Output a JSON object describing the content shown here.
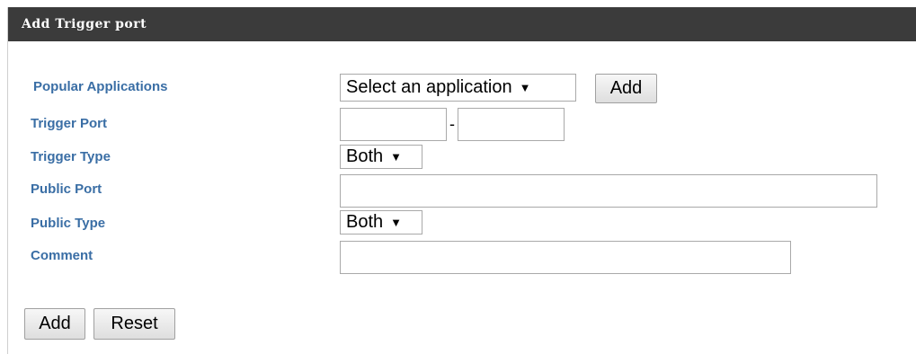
{
  "header": {
    "title": "Add Trigger port"
  },
  "form": {
    "popular_applications": {
      "label": "Popular Applications",
      "select_value": "Select an application",
      "add_label": "Add"
    },
    "trigger_port": {
      "label": "Trigger Port",
      "start_value": "",
      "separator": "-",
      "end_value": ""
    },
    "trigger_type": {
      "label": "Trigger Type",
      "select_value": "Both"
    },
    "public_port": {
      "label": "Public Port",
      "value": ""
    },
    "public_type": {
      "label": "Public Type",
      "select_value": "Both"
    },
    "comment": {
      "label": "Comment",
      "value": ""
    }
  },
  "actions": {
    "add_label": "Add",
    "reset_label": "Reset"
  },
  "icons": {
    "dropdown_caret": "▼"
  },
  "colors": {
    "header_bg": "#3b3b3b",
    "label_color": "#3a6ea5"
  }
}
